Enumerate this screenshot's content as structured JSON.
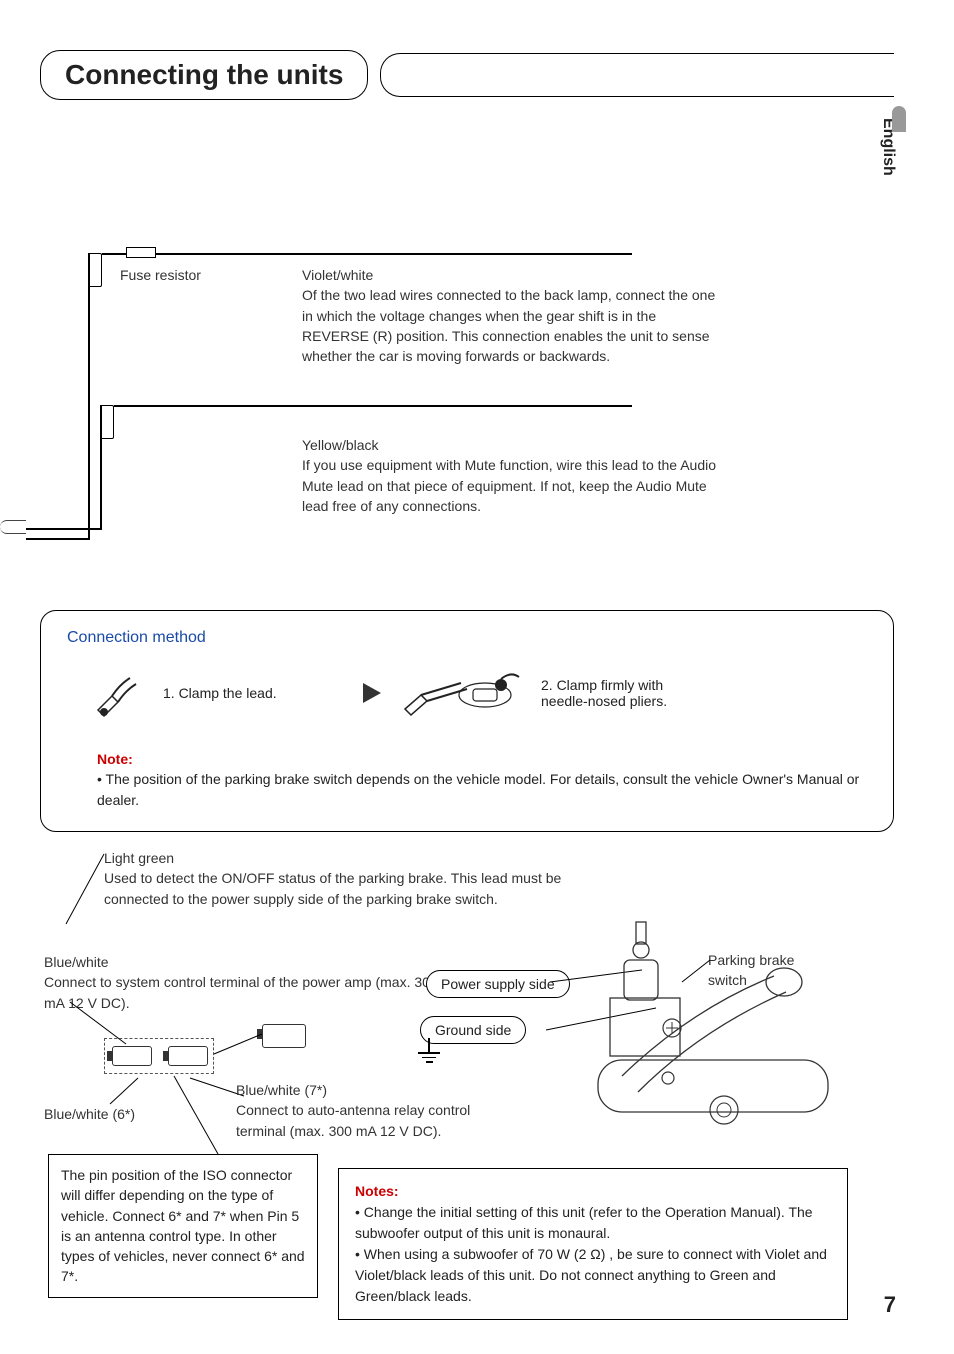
{
  "page": {
    "title": "Connecting the units",
    "language_tab": "English",
    "page_number": "7"
  },
  "wires": {
    "fuse_label": "Fuse resistor",
    "violet": {
      "color": "Violet/white",
      "desc": "Of the two lead wires connected to the back lamp, connect the one in which the voltage changes when the gear shift is in the REVERSE (R) position. This connection enables the unit to sense whether the car is moving forwards or backwards."
    },
    "yellow": {
      "color": "Yellow/black",
      "desc": "If you use equipment with Mute function, wire this lead to the Audio Mute lead on that piece of equipment. If not, keep the Audio Mute lead free of any connections."
    }
  },
  "connection_method": {
    "title": "Connection method",
    "step1": "1. Clamp the lead.",
    "step2": "2. Clamp firmly with needle-nosed pliers.",
    "note_label": "Note:",
    "note_body": "The position of the parking brake switch depends on the vehicle model. For details, consult the vehicle Owner's Manual or dealer."
  },
  "labels": {
    "light_green_head": "Light green",
    "light_green_body": "Used to detect the ON/OFF status of the parking brake. This lead must be connected to the power supply side of the parking brake switch.",
    "blue_white_head": "Blue/white",
    "blue_white_body": "Connect to system control terminal of the power amp (max. 300 mA 12 V DC).",
    "blue_white_6": "Blue/white (6*)",
    "blue_white_7": "Blue/white (7*)",
    "blue_white_7_body": "Connect to auto-antenna relay control terminal (max. 300 mA 12 V DC).",
    "power_supply_side": "Power supply side",
    "ground_side": "Ground side",
    "parking_brake_switch": "Parking brake switch"
  },
  "iso_note": "The pin position of the ISO connector will differ depending on the type of vehicle. Connect 6* and 7* when Pin 5 is an antenna control type. In other types of vehicles, never connect 6* and 7*.",
  "notes_box": {
    "heading": "Notes:",
    "item1": "Change the initial setting of this unit (refer to the Operation Manual). The subwoofer output of this unit is monaural.",
    "item2": "When using a subwoofer of 70 W (2 Ω) , be sure to connect with Violet and Violet/black leads of this unit. Do not connect anything to Green and Green/black leads."
  }
}
